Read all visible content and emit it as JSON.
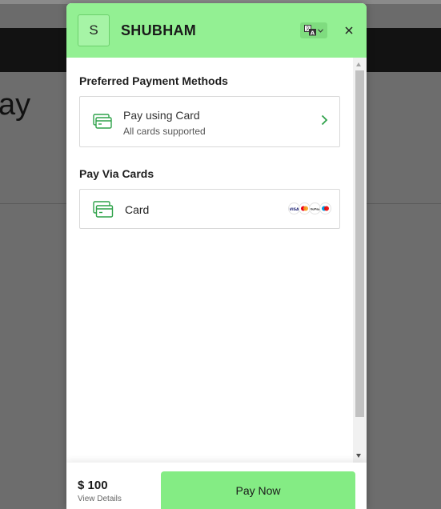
{
  "background": {
    "title_fragment": "ay"
  },
  "header": {
    "avatar_letter": "S",
    "merchant_name": "SHUBHAM",
    "language_icon": "translate-icon",
    "close_icon": "close-icon"
  },
  "preferred": {
    "heading": "Preferred Payment Methods",
    "method_title": "Pay using Card",
    "method_subtitle": "All cards supported"
  },
  "cards": {
    "heading": "Pay Via Cards",
    "label": "Card",
    "networks": [
      "VISA",
      "Mastercard",
      "RuPay",
      "Maestro"
    ]
  },
  "footer": {
    "amount": "$ 100",
    "view_details": "View Details",
    "pay_button": "Pay Now"
  },
  "colors": {
    "header_green": "#93f093",
    "button_green": "#84ec84",
    "icon_green": "#2fa24a"
  }
}
